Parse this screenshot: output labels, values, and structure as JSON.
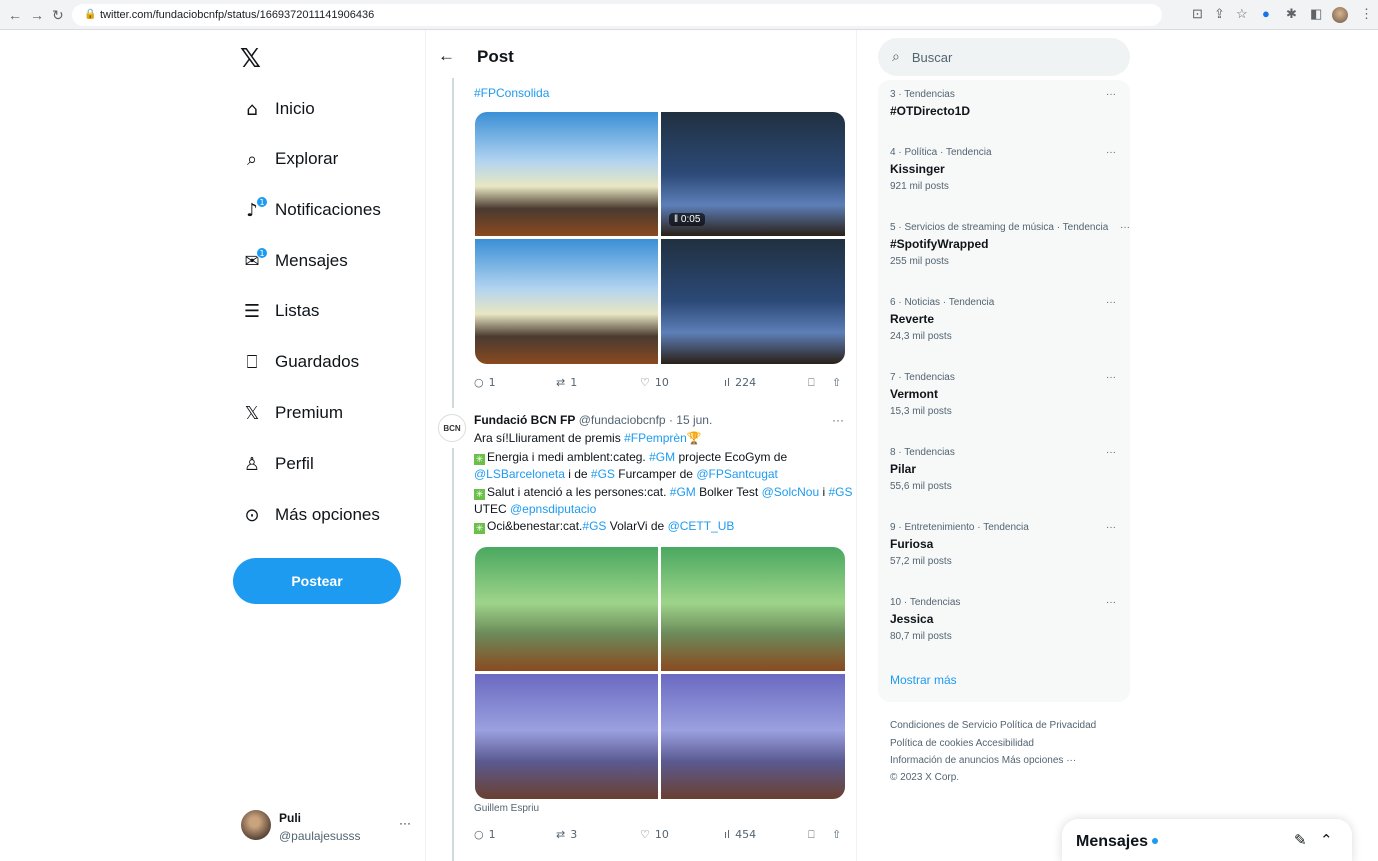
{
  "browser": {
    "url": "twitter.com/fundaciobcnfp/status/1669372011141906436"
  },
  "sidebar": {
    "items": [
      {
        "label": "Inicio",
        "icon": "home-icon",
        "glyph": "⌂"
      },
      {
        "label": "Explorar",
        "icon": "search-icon",
        "glyph": "⌕"
      },
      {
        "label": "Notificaciones",
        "icon": "bell-icon",
        "glyph": "♫",
        "badge": "1"
      },
      {
        "label": "Mensajes",
        "icon": "mail-icon",
        "glyph": "✉",
        "badge": "1"
      },
      {
        "label": "Listas",
        "icon": "list-icon",
        "glyph": "☰"
      },
      {
        "label": "Guardados",
        "icon": "bookmark-icon",
        "glyph": "⚑"
      },
      {
        "label": "Premium",
        "icon": "x-logo-icon",
        "glyph": "𝕏"
      },
      {
        "label": "Perfil",
        "icon": "person-icon",
        "glyph": "♙"
      },
      {
        "label": "Más opciones",
        "icon": "more-circle-icon",
        "glyph": "⋯"
      }
    ],
    "post_button": "Postear",
    "account": {
      "name": "Puli",
      "handle": "@paulajesusss",
      "more": "···"
    }
  },
  "main": {
    "title": "Post",
    "top_hashtag": "#FPConsolida",
    "first_tweet": {
      "video_time": "0:05",
      "replies": "1",
      "retweets": "1",
      "likes": "10",
      "views": "224"
    },
    "second_tweet": {
      "author": "Fundació BCN FP",
      "handle": "@fundaciobcnfp",
      "date": "· 15 jun.",
      "avatar_text": "BCN",
      "lines": [
        {
          "a": "Ara sí!Lliurament de premis ",
          "b": "#FPemprèn",
          "c": "🏆"
        },
        {
          "a": "Energia i medi amblent:categ. ",
          "b": "#GM",
          "c": " projecte EcoGym de"
        },
        {
          "a": "@LSBarceloneta",
          "b": " i de ",
          "c": "#GS",
          "d": " Furcamper de ",
          "e": "@FPSantcugat"
        },
        {
          "a": "Salut i atenció a les persones:cat. ",
          "b": "#GM",
          "c": " Bolker Test ",
          "d": "@SolcNou",
          "e": " i ",
          "f": "#GS"
        },
        {
          "a": "UTEC ",
          "b": "@epnsdiputacio"
        },
        {
          "a": "Oci&benestar:cat.",
          "b": "#GS",
          "c": " VolarVi de ",
          "d": "@CETT_UB"
        }
      ],
      "credit": "Guillem Espriu",
      "replies": "1",
      "retweets": "3",
      "likes": "10",
      "views": "454"
    }
  },
  "right": {
    "search_placeholder": "Buscar",
    "trends": [
      {
        "cat": "3 · Tendencias",
        "name": "#OTDirecto1D",
        "count": ""
      },
      {
        "cat": "4 · Política · Tendencia",
        "name": "Kissinger",
        "count": "921 mil posts"
      },
      {
        "cat": "5 · Servicios de streaming de música · Tendencia",
        "name": "#SpotifyWrapped",
        "count": "255 mil posts"
      },
      {
        "cat": "6 · Noticias · Tendencia",
        "name": "Reverte",
        "count": "24,3 mil posts"
      },
      {
        "cat": "7 · Tendencias",
        "name": "Vermont",
        "count": "15,3 mil posts"
      },
      {
        "cat": "8 · Tendencias",
        "name": "Pilar",
        "count": "55,6 mil posts"
      },
      {
        "cat": "9 · Entretenimiento · Tendencia",
        "name": "Furiosa",
        "count": "57,2 mil posts"
      },
      {
        "cat": "10 · Tendencias",
        "name": "Jessica",
        "count": "80,7 mil posts"
      }
    ],
    "show_more": "Mostrar más",
    "footer": [
      "Condiciones de Servicio   Política de Privacidad",
      "Política de cookies   Accesibilidad",
      "Información de anuncios   Más opciones ···",
      "© 2023 X Corp."
    ],
    "messages": "Mensajes"
  },
  "colors": {
    "accent": "#1d9bf0"
  }
}
